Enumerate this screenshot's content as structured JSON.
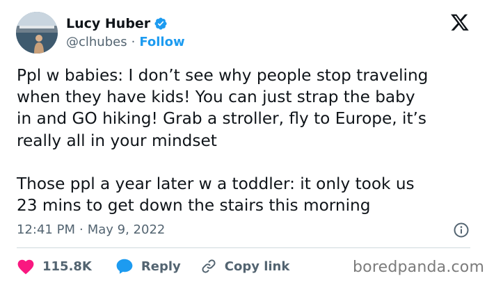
{
  "author": {
    "name": "Lucy Huber",
    "handle": "@clhubes",
    "separator": "·",
    "follow_label": "Follow",
    "verified": true
  },
  "tweet": {
    "text": "Ppl w babies: I don’t see why people stop traveling\nwhen they have kids! You can just strap the baby\nin and GO hiking! Grab a stroller, fly to Europe, it’s\nreally all in your mindset\n\nThose ppl a year later w a toddler: it only took us\n23 mins to get down the stairs this morning",
    "time": "12:41 PM",
    "date": "May 9, 2022",
    "meta_separator": "·"
  },
  "actions": {
    "likes": "115.8K",
    "reply_label": "Reply",
    "copy_label": "Copy link"
  },
  "watermark": "boredpanda.com",
  "icons": {
    "x_logo": "x-logo-icon",
    "verified": "verified-badge-icon",
    "info": "info-icon",
    "heart": "heart-icon",
    "reply": "reply-bubble-icon",
    "link": "link-icon"
  },
  "colors": {
    "text": "#0f1419",
    "secondary": "#536471",
    "accent": "#1d9bf0",
    "heart": "#f91880",
    "divider": "#cfd9de"
  }
}
